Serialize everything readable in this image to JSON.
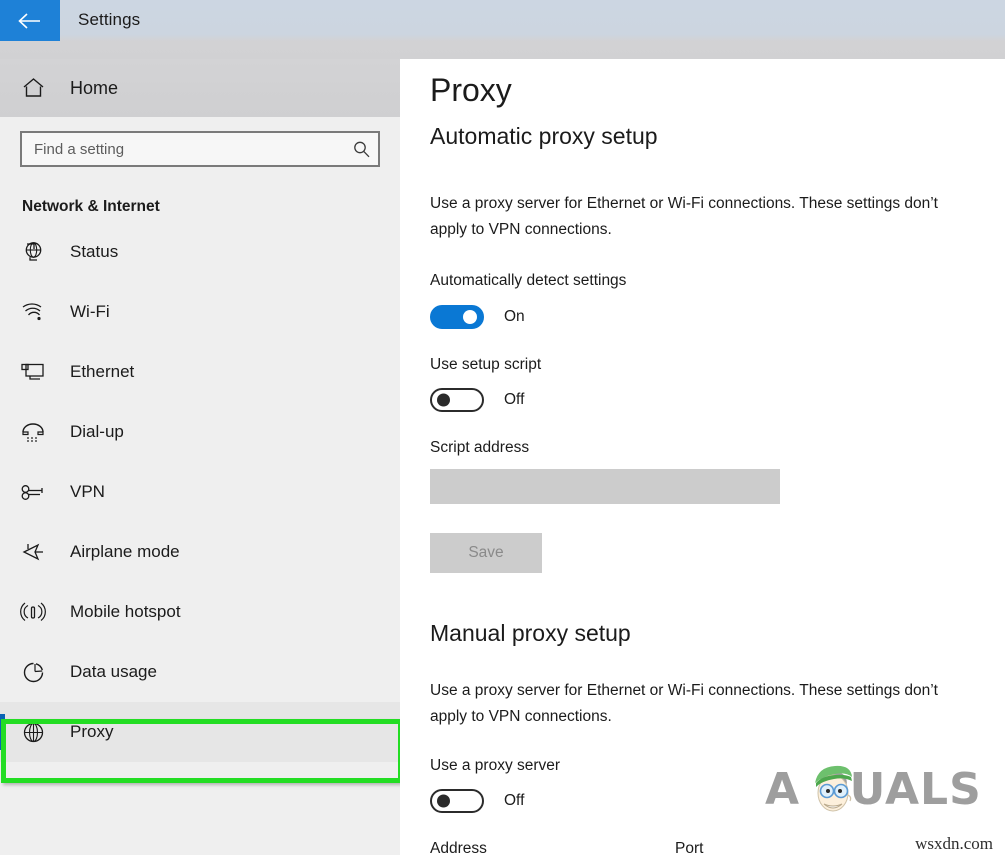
{
  "titlebar": {
    "back_icon": "back-arrow-icon",
    "title": "Settings",
    "accent_color": "#1e81d7"
  },
  "sidebar": {
    "home": {
      "icon": "home-icon",
      "label": "Home"
    },
    "search": {
      "icon": "search-icon",
      "value": "",
      "placeholder": "Find a setting"
    },
    "group_title": "Network & Internet",
    "selected_index": 7,
    "selection_color": "#0a63b5",
    "highlight_color": "#23dd23",
    "items": [
      {
        "icon": "globe-monitor-icon",
        "label": "Status"
      },
      {
        "icon": "wifi-icon",
        "label": "Wi-Fi"
      },
      {
        "icon": "ethernet-icon",
        "label": "Ethernet"
      },
      {
        "icon": "dialup-phone-icon",
        "label": "Dial-up"
      },
      {
        "icon": "vpn-key-icon",
        "label": "VPN"
      },
      {
        "icon": "airplane-icon",
        "label": "Airplane mode"
      },
      {
        "icon": "mobile-hotspot-icon",
        "label": "Mobile hotspot"
      },
      {
        "icon": "data-usage-pie-icon",
        "label": "Data usage"
      },
      {
        "icon": "globe-icon",
        "label": "Proxy"
      }
    ]
  },
  "main": {
    "page_title": "Proxy",
    "automatic": {
      "heading": "Automatic proxy setup",
      "description": "Use a proxy server for Ethernet or Wi-Fi connections. These settings don’t apply to VPN connections.",
      "auto_detect": {
        "label": "Automatically detect settings",
        "state": "On",
        "on": true
      },
      "setup_script": {
        "label": "Use setup script",
        "state": "Off",
        "on": false
      },
      "script_address": {
        "label": "Script address",
        "value": "",
        "placeholder": ""
      },
      "save_button": "Save"
    },
    "manual": {
      "heading": "Manual proxy setup",
      "description": "Use a proxy server for Ethernet or Wi-Fi connections. These settings don’t apply to VPN connections.",
      "use_proxy": {
        "label": "Use a proxy server",
        "state": "Off",
        "on": false
      },
      "address_label": "Address",
      "port_label": "Port"
    }
  },
  "watermark": {
    "brand": "A   PUALS",
    "site": "wsxdn.com"
  }
}
